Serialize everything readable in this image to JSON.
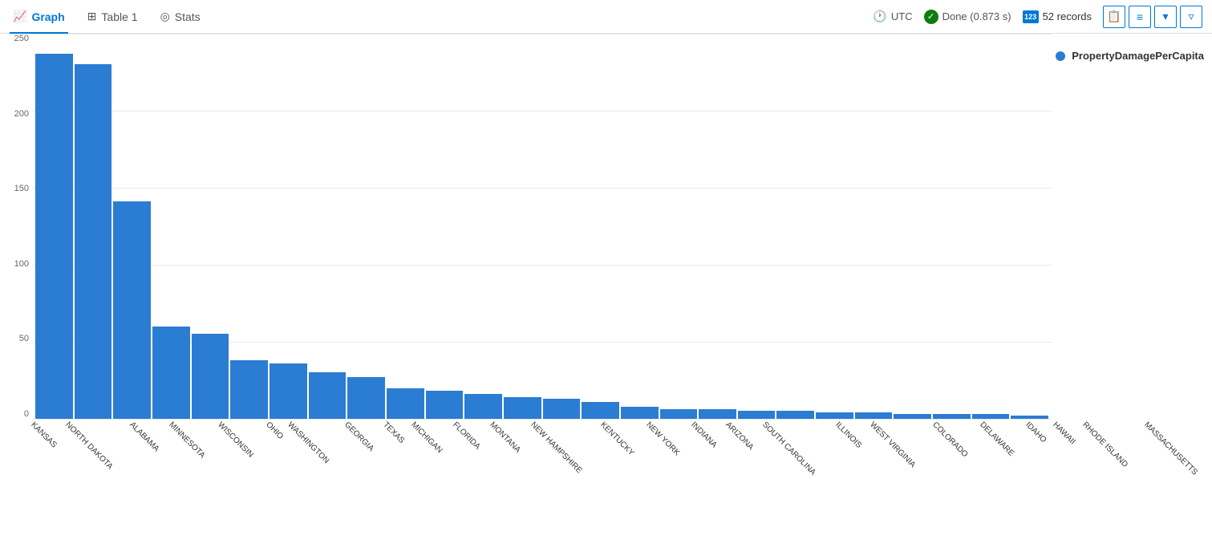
{
  "tabs": [
    {
      "id": "graph",
      "label": "Graph",
      "icon": "📈",
      "active": true
    },
    {
      "id": "table1",
      "label": "Table 1",
      "icon": "⊞",
      "active": false
    },
    {
      "id": "stats",
      "label": "Stats",
      "icon": "◎",
      "active": false
    }
  ],
  "toolbar": {
    "utc_label": "UTC",
    "done_label": "Done (0.873 s)",
    "records_label": "52 records",
    "records_icon": "123"
  },
  "chart": {
    "legend_label": "PropertyDamagePerCapita",
    "y_axis": [
      "250",
      "200",
      "150",
      "100",
      "50",
      "0"
    ],
    "bars": [
      {
        "label": "KANSAS",
        "value": 237
      },
      {
        "label": "NORTH DAKOTA",
        "value": 230
      },
      {
        "label": "ALABAMA",
        "value": 141
      },
      {
        "label": "MINNESOTA",
        "value": 60
      },
      {
        "label": "WISCONSIN",
        "value": 55
      },
      {
        "label": "OHIO",
        "value": 38
      },
      {
        "label": "WASHINGTON",
        "value": 36
      },
      {
        "label": "GEORGIA",
        "value": 30
      },
      {
        "label": "TEXAS",
        "value": 27
      },
      {
        "label": "MICHIGAN",
        "value": 20
      },
      {
        "label": "FLORIDA",
        "value": 18
      },
      {
        "label": "MONTANA",
        "value": 16
      },
      {
        "label": "NEW HAMPSHIRE",
        "value": 14
      },
      {
        "label": "KENTUCKY",
        "value": 13
      },
      {
        "label": "NEW YORK",
        "value": 11
      },
      {
        "label": "INDIANA",
        "value": 8
      },
      {
        "label": "ARIZONA",
        "value": 6
      },
      {
        "label": "SOUTH CAROLINA",
        "value": 6
      },
      {
        "label": "ILLINOIS",
        "value": 5
      },
      {
        "label": "WEST VIRGINIA",
        "value": 5
      },
      {
        "label": "COLORADO",
        "value": 4
      },
      {
        "label": "DELAWARE",
        "value": 4
      },
      {
        "label": "IDAHO",
        "value": 3
      },
      {
        "label": "HAWAII",
        "value": 3
      },
      {
        "label": "RHODE ISLAND",
        "value": 3
      },
      {
        "label": "MASSACHUSETTS",
        "value": 2
      }
    ],
    "max_value": 250
  }
}
